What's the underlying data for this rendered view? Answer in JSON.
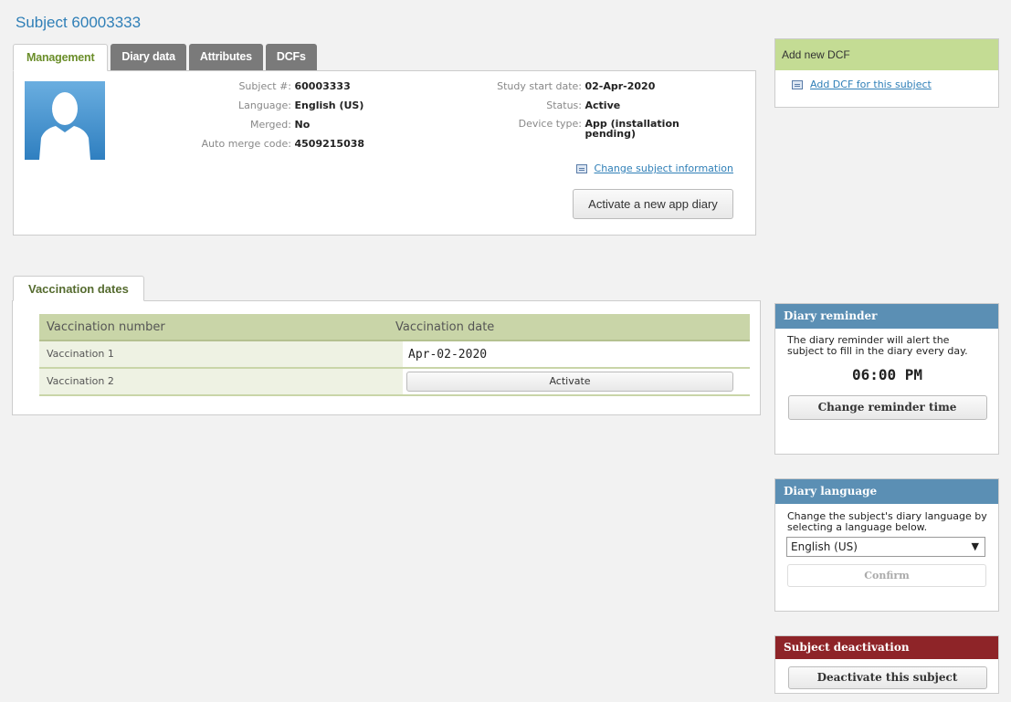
{
  "page": {
    "title": "Subject 60003333"
  },
  "tabs": [
    {
      "label": "Management",
      "active": true
    },
    {
      "label": "Diary data",
      "active": false
    },
    {
      "label": "Attributes",
      "active": false
    },
    {
      "label": "DCFs",
      "active": false
    }
  ],
  "subject": {
    "subject_no_label": "Subject #:",
    "subject_no": "60003333",
    "language_label": "Language:",
    "language": "English (US)",
    "merged_label": "Merged:",
    "merged": "No",
    "merge_code_label": "Auto merge code:",
    "merge_code": "4509215038",
    "start_date_label": "Study start date:",
    "start_date": "02-Apr-2020",
    "status_label": "Status:",
    "status": "Active",
    "device_label": "Device type:",
    "device_line1": "App (installation",
    "device_line2": "pending)",
    "change_info_link": "Change subject information",
    "activate_app_button": "Activate a new app diary"
  },
  "vaccination": {
    "tab_label": "Vaccination dates",
    "headers": [
      "Vaccination number",
      "Vaccination date"
    ],
    "rows": [
      {
        "name": "Vaccination 1",
        "date": "Apr-02-2020"
      },
      {
        "name": "Vaccination 2",
        "button": "Activate"
      }
    ]
  },
  "sidebar": {
    "dcf": {
      "title": "Add new DCF",
      "link": "Add DCF for this subject"
    },
    "reminder": {
      "title": "Diary reminder",
      "text": "The diary reminder will alert the subject to fill in the diary every day.",
      "time": "06:00 PM",
      "button": "Change reminder time"
    },
    "language": {
      "title": "Diary language",
      "text": "Change the subject's diary language by selecting a language below.",
      "selected": "English (US)",
      "button": "Confirm"
    },
    "deactivation": {
      "title": "Subject deactivation",
      "button": "Deactivate this subject"
    }
  },
  "colors": {
    "title_blue": "#2f7fb7",
    "table_header_green": "#c9d5a8",
    "sidebar_blue": "#5b8fb4",
    "dcf_green": "#c4dc94",
    "deactivate_red": "#8e2428"
  }
}
